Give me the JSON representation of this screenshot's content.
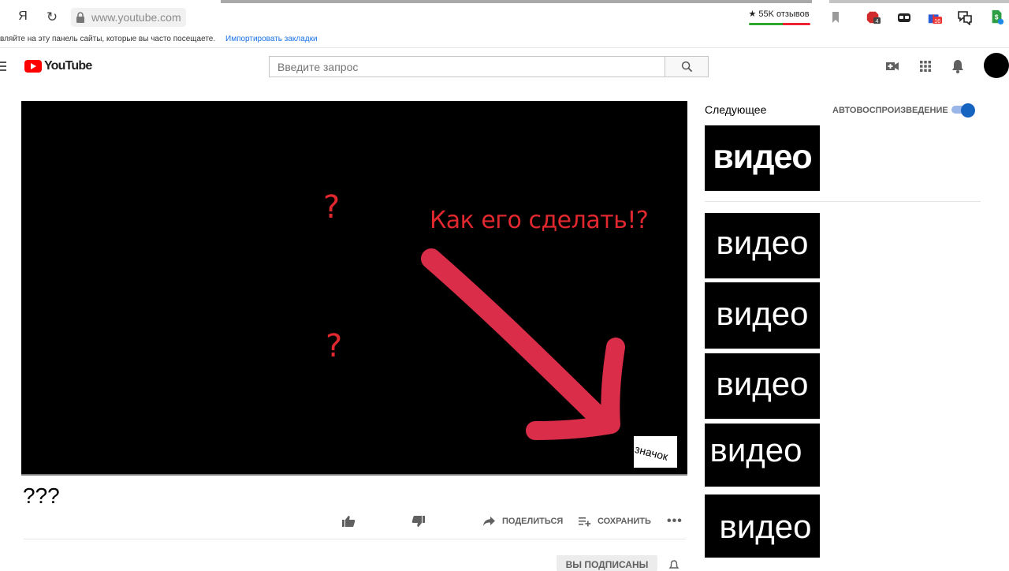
{
  "browser": {
    "ya_label": "Я",
    "url": "www.youtube.com",
    "reviews": "★ 55K отзывов",
    "bookmarks_text": "вляйте на эту панель сайты, которые вы часто посещаете.",
    "bookmarks_link": "Импортировать закладки",
    "ext_badges": [
      "4",
      "16"
    ]
  },
  "header": {
    "logo_text": "YouTube",
    "search_placeholder": "Введите запрос"
  },
  "player": {
    "question_1": "?",
    "question_2": "?",
    "caption": "Как его сделать!?",
    "badge_text": "значок",
    "accent": "#e0282e"
  },
  "video": {
    "title": "???",
    "share_label": "ПОДЕЛИТЬСЯ",
    "save_label": "СОХРАНИТЬ",
    "more_label": "•••",
    "subscribed_label": "ВЫ ПОДПИСАНЫ"
  },
  "sidebar": {
    "up_next": "Следующее",
    "autoplay_label": "АВТОВОСПРОИЗВЕДЕНИЕ",
    "autoplay_on": true,
    "thumbnails": [
      "видео",
      "видео",
      "видео",
      "видео",
      "видео",
      "видео"
    ]
  }
}
